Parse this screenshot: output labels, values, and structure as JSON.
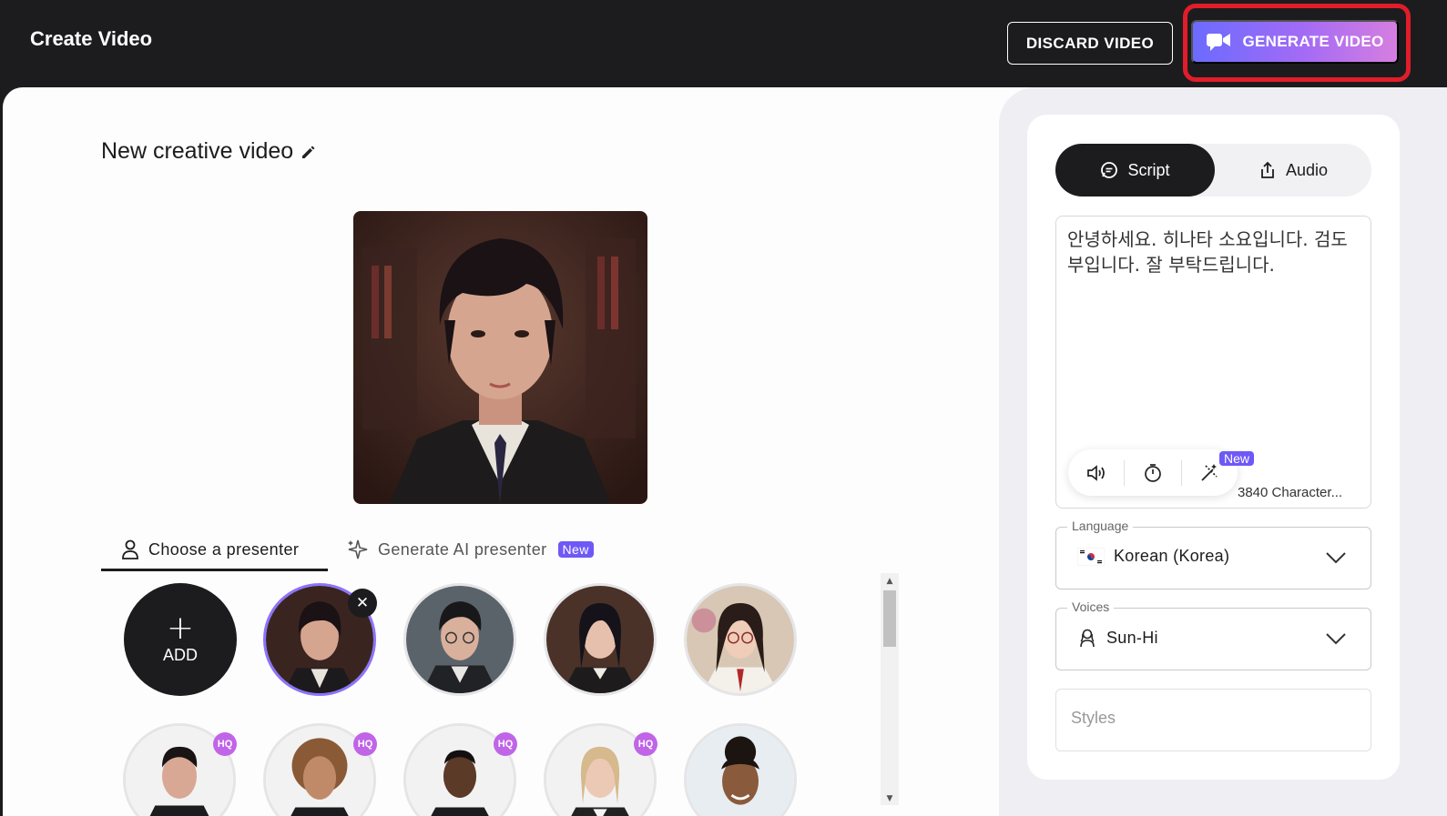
{
  "header": {
    "title": "Create Video",
    "discard_label": "DISCARD VIDEO",
    "generate_label": "GENERATE VIDEO",
    "generate_icon": "video-camera-icon",
    "highlight_color": "#e11d2a"
  },
  "editor": {
    "video_title": "New creative video",
    "edit_icon": "pencil-icon"
  },
  "presenter_tabs": {
    "choose_label": "Choose a presenter",
    "generate_label": "Generate AI presenter",
    "new_badge": "New"
  },
  "presenters": {
    "add_label": "ADD",
    "add_symbol": "+",
    "remove_symbol": "✕",
    "hq_badge": "HQ"
  },
  "script_panel": {
    "script_tab": "Script",
    "audio_tab": "Audio",
    "script_text": "안녕하세요. 히나타 소요입니다. 검도부입니다. 잘 부탁드립니다.",
    "tool_new_badge": "New",
    "char_count": "3840 Character..."
  },
  "language": {
    "label": "Language",
    "value": "Korean (Korea)"
  },
  "voices": {
    "label": "Voices",
    "value": "Sun-Hi"
  },
  "styles": {
    "placeholder": "Styles"
  },
  "colors": {
    "accent_purple": "#6e59f7",
    "hq_badge": "#c064e8",
    "dark": "#1c1c1e"
  }
}
